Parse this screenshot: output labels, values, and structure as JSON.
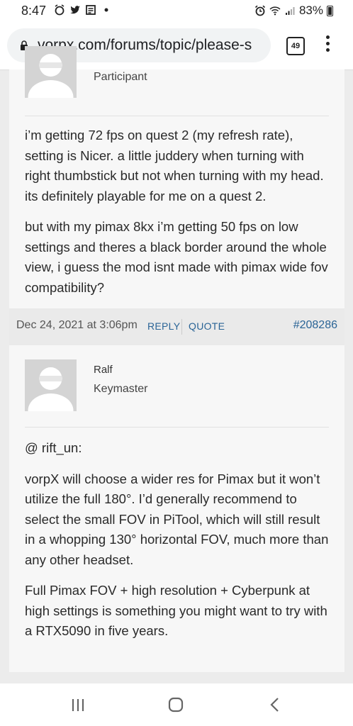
{
  "status_bar": {
    "time": "8:47",
    "battery_percent": "83%"
  },
  "browser": {
    "url": "vorpx.com/forums/topic/please-s",
    "tab_count": "49"
  },
  "post1": {
    "role": "Participant",
    "paragraphs": [
      "i’m getting 72 fps on quest 2 (my refresh rate), setting is Nicer. a little juddery when turning with right thumbstick but not when turning with my head. its definitely playable for me on a quest 2.",
      "but with my pimax 8kx i’m getting 50 fps on low settings and theres a black border around the whole view, i guess the mod isnt made with pimax wide fov compatibility?"
    ]
  },
  "meta": {
    "date": "Dec 24, 2021 at 3:06pm",
    "reply": "REPLY",
    "quote": "QUOTE",
    "post_id": "#208286"
  },
  "post2": {
    "name": "Ralf",
    "role": "Keymaster",
    "paragraphs": [
      "@ rift_un:",
      "vorpX will choose a wider res for Pimax but it won’t utilize the full 180°. I’d generally recommend to select the small FOV in PiTool, which will still result in a whopping 130° horizontal FOV, much more than any other headset.",
      "Full Pimax FOV + high resolution + Cyberpunk at high settings is something you might want to try with a RTX5090 in five years."
    ]
  },
  "icons": {
    "status_left": [
      "alarm-icon",
      "twitter-icon",
      "news-icon",
      "dot-icon"
    ],
    "status_right": [
      "alarm-clock-icon",
      "wifi-icon",
      "signal-icon",
      "battery-icon"
    ],
    "nav": [
      "recent-apps-icon",
      "home-icon",
      "back-icon"
    ]
  }
}
